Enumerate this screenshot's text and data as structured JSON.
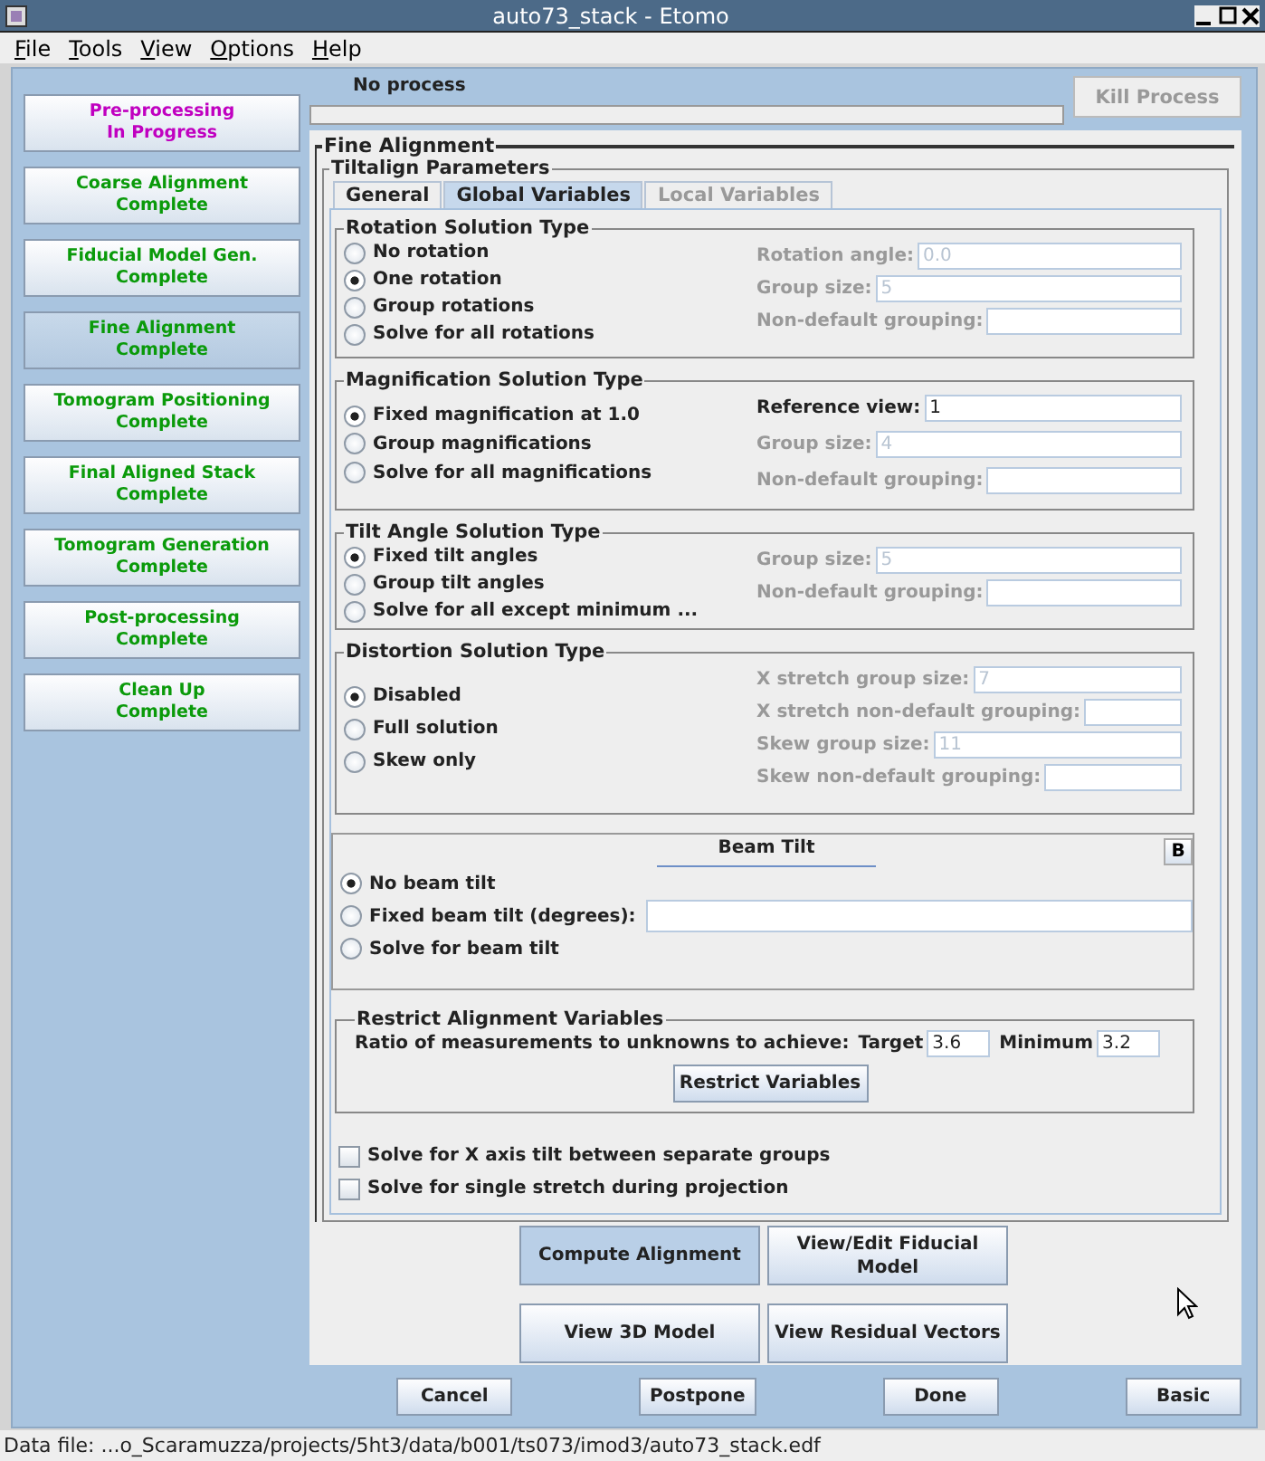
{
  "window": {
    "title": "auto73_stack - Etomo"
  },
  "menu": [
    {
      "label": "File"
    },
    {
      "label": "Tools"
    },
    {
      "label": "View"
    },
    {
      "label": "Options"
    },
    {
      "label": "Help"
    }
  ],
  "sidebar": {
    "items": [
      {
        "name": "Pre-processing",
        "status": "In Progress",
        "kind": "in_progress",
        "selected": false
      },
      {
        "name": "Coarse Alignment",
        "status": "Complete",
        "kind": "complete",
        "selected": false
      },
      {
        "name": "Fiducial Model Gen.",
        "status": "Complete",
        "kind": "complete",
        "selected": false
      },
      {
        "name": "Fine Alignment",
        "status": "Complete",
        "kind": "complete",
        "selected": true
      },
      {
        "name": "Tomogram Positioning",
        "status": "Complete",
        "kind": "complete",
        "selected": false
      },
      {
        "name": "Final Aligned Stack",
        "status": "Complete",
        "kind": "complete",
        "selected": false
      },
      {
        "name": "Tomogram Generation",
        "status": "Complete",
        "kind": "complete",
        "selected": false
      },
      {
        "name": "Post-processing",
        "status": "Complete",
        "kind": "complete",
        "selected": false
      },
      {
        "name": "Clean Up",
        "status": "Complete",
        "kind": "complete",
        "selected": false
      }
    ]
  },
  "process": {
    "label": "No process",
    "level": 0,
    "kill_button": {
      "label": "Kill Process",
      "disabled": true
    }
  },
  "panel": {
    "title": "Fine Alignment",
    "subtitle": "Tiltalign Parameters",
    "tabs": [
      {
        "label": "General",
        "selected": false,
        "disabled": false
      },
      {
        "label": "Global Variables",
        "selected": true,
        "disabled": false
      },
      {
        "label": "Local Variables",
        "selected": false,
        "disabled": true
      }
    ],
    "groups": [
      {
        "title": "Rotation Solution Type",
        "options": [
          {
            "label": "No rotation",
            "selected": false
          },
          {
            "label": "One rotation",
            "selected": true
          },
          {
            "label": "Group rotations",
            "selected": false
          },
          {
            "label": "Solve for all rotations",
            "selected": false
          }
        ],
        "fields": [
          {
            "label": "Rotation angle:",
            "value": "0.0",
            "disabled": true
          },
          {
            "label": "Group size:",
            "value": "5",
            "disabled": true
          },
          {
            "label": "Non-default grouping:",
            "disabled": true
          }
        ]
      },
      {
        "title": "Magnification Solution Type",
        "options": [
          {
            "label": "Fixed magnification at 1.0",
            "selected": true
          },
          {
            "label": "Group magnifications",
            "selected": false
          },
          {
            "label": "Solve for all magnifications",
            "selected": false
          }
        ],
        "fields": [
          {
            "label": "Reference view:",
            "value": "1",
            "disabled": false
          },
          {
            "label": "Group size:",
            "value": "4",
            "disabled": true
          },
          {
            "label": "Non-default grouping:",
            "disabled": true
          }
        ]
      },
      {
        "title": "Tilt Angle Solution Type",
        "options": [
          {
            "label": "Fixed tilt angles",
            "selected": true
          },
          {
            "label": "Group tilt angles",
            "selected": false
          },
          {
            "label": "Solve for all except minimum ...",
            "selected": false
          }
        ],
        "fields": [
          {
            "label": "Group size:",
            "value": "5",
            "disabled": true
          },
          {
            "label": "Non-default grouping:",
            "disabled": true
          }
        ]
      },
      {
        "title": "Distortion Solution Type",
        "options": [
          {
            "label": "Disabled",
            "selected": true
          },
          {
            "label": "Full solution",
            "selected": false
          },
          {
            "label": "Skew only",
            "selected": false
          }
        ],
        "fields": [
          {
            "label": "X stretch group size:",
            "value": "7",
            "disabled": true
          },
          {
            "label": "X stretch non-default grouping:",
            "disabled": true
          },
          {
            "label": "Skew group size:",
            "value": "11",
            "disabled": true
          },
          {
            "label": "Skew non-default grouping:",
            "disabled": true
          }
        ]
      }
    ],
    "beam_tilt": {
      "title": "Beam Tilt",
      "toggle": "B",
      "options": [
        {
          "label": "No beam tilt",
          "selected": true,
          "kind": "radio"
        },
        {
          "label": "Fixed beam tilt (degrees):",
          "selected": false,
          "kind": "radio_field"
        },
        {
          "label": "Solve for beam tilt",
          "selected": false,
          "kind": "radio"
        }
      ]
    },
    "restrict": {
      "title": "Restrict Alignment Variables",
      "ratio_label": "Ratio of measurements to unknowns to achieve:",
      "target_label": "Target",
      "target_value": "3.6",
      "minimum_label": "Minimum",
      "minimum_value": "3.2",
      "button": "Restrict Variables"
    },
    "checkboxes": [
      {
        "label": "Solve for X axis tilt between separate groups",
        "checked": false
      },
      {
        "label": "Solve for single stretch during projection",
        "checked": false
      }
    ],
    "action_rows": [
      [
        {
          "label": "Compute Alignment",
          "highlighted": true
        },
        {
          "label": "View/Edit Fiducial Model",
          "highlighted": false
        }
      ],
      [
        {
          "label": "View 3D Model",
          "highlighted": false
        },
        {
          "label": "View Residual Vectors",
          "highlighted": false
        }
      ]
    ]
  },
  "footer_buttons": [
    "Cancel",
    "Postpone",
    "Done",
    "Basic"
  ],
  "status_bar": "Data file: ...o_Scaramuzza/projects/5ht3/data/b001/ts073/imod3/auto73_stack.edf"
}
